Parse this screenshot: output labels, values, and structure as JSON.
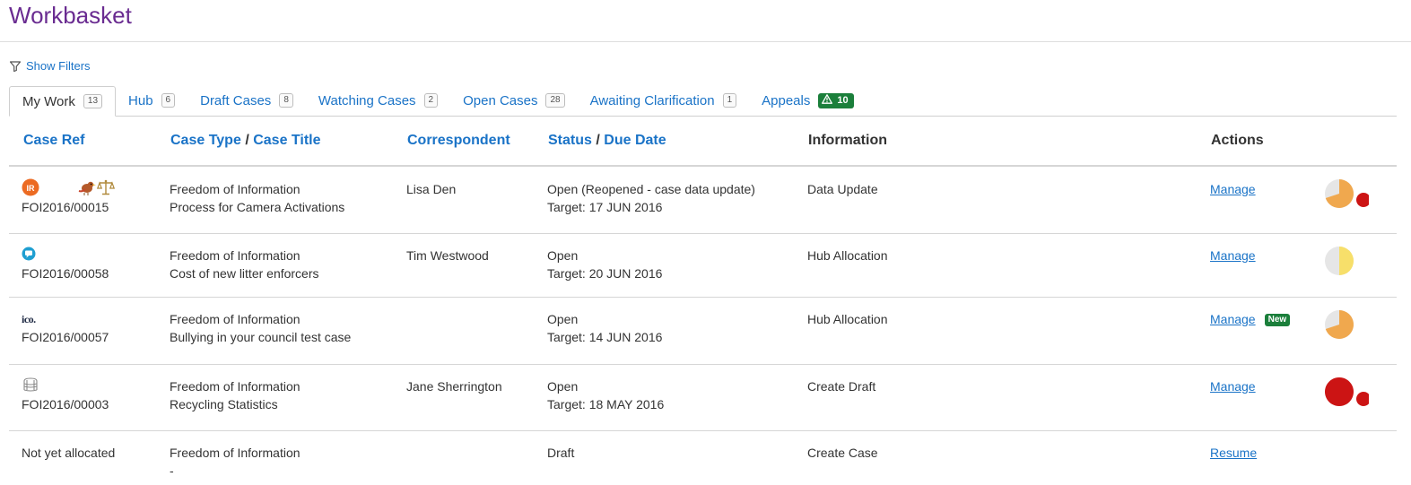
{
  "page": {
    "title": "Workbasket"
  },
  "filters": {
    "label": "Show Filters",
    "icon": "filter-icon"
  },
  "tabs": [
    {
      "label": "My Work",
      "count": "13",
      "active": true
    },
    {
      "label": "Hub",
      "count": "6"
    },
    {
      "label": "Draft Cases",
      "count": "8"
    },
    {
      "label": "Watching Cases",
      "count": "2"
    },
    {
      "label": "Open Cases",
      "count": "28"
    },
    {
      "label": "Awaiting Clarification",
      "count": "1"
    },
    {
      "label": "Appeals",
      "count": "10",
      "badge_icon": "warning-icon",
      "badge_color": "#1b7f3b"
    }
  ],
  "columns": {
    "case_ref": "Case Ref",
    "case_type": "Case Type",
    "slash": "/",
    "case_title": "Case Title",
    "correspondent": "Correspondent",
    "status": "Status",
    "due_date": "Due Date",
    "information": "Information",
    "actions": "Actions"
  },
  "rows": [
    {
      "ref": "FOI2016/00015",
      "icons": [
        "ir-badge-icon",
        "bird-icon",
        "scales-icon"
      ],
      "ir_label": "IR",
      "type": "Freedom of Information",
      "title": "Process for Camera Activations",
      "correspondent": "Lisa Den",
      "status": "Open (Reopened - case data update)",
      "target": "Target: 17 JUN 2016",
      "information": "Data Update",
      "action": "Manage",
      "progress": 0.7,
      "progress_color": "#f0a84e",
      "overdue_dot": true
    },
    {
      "ref": "FOI2016/00058",
      "icons": [
        "chat-bubble-icon"
      ],
      "type": "Freedom of Information",
      "title": "Cost of new litter enforcers",
      "correspondent": "Tim Westwood",
      "status": "Open",
      "target": "Target: 20 JUN 2016",
      "information": "Hub Allocation",
      "action": "Manage",
      "progress": 0.5,
      "progress_color": "#f7df6a",
      "overdue_dot": false
    },
    {
      "ref": "FOI2016/00057",
      "icons": [
        "ico-logo-icon"
      ],
      "ico_label": "ico.",
      "type": "Freedom of Information",
      "title": "Bullying in your council test case",
      "correspondent": "",
      "status": "Open",
      "target": "Target: 14 JUN 2016",
      "information": "Hub Allocation",
      "action": "Manage",
      "new_badge": "New",
      "progress": 0.7,
      "progress_color": "#f0a84e",
      "overdue_dot": false
    },
    {
      "ref": "FOI2016/00003",
      "icons": [
        "stack-icon"
      ],
      "type": "Freedom of Information",
      "title": "Recycling Statistics",
      "correspondent": "Jane Sherrington",
      "status": "Open",
      "target": "Target: 18 MAY 2016",
      "information": "Create Draft",
      "action": "Manage",
      "progress": 1.0,
      "progress_color": "#cc1414",
      "overdue_dot": true
    },
    {
      "ref": "Not yet allocated",
      "icons": [],
      "type": "Freedom of Information",
      "title": "-",
      "correspondent": "",
      "status": "Draft",
      "target": "",
      "information": "Create Case",
      "action": "Resume"
    }
  ],
  "colors": {
    "title": "#6a2c91",
    "link": "#1a73c7",
    "green_badge": "#1b7f3b",
    "overdue": "#cc1414"
  }
}
